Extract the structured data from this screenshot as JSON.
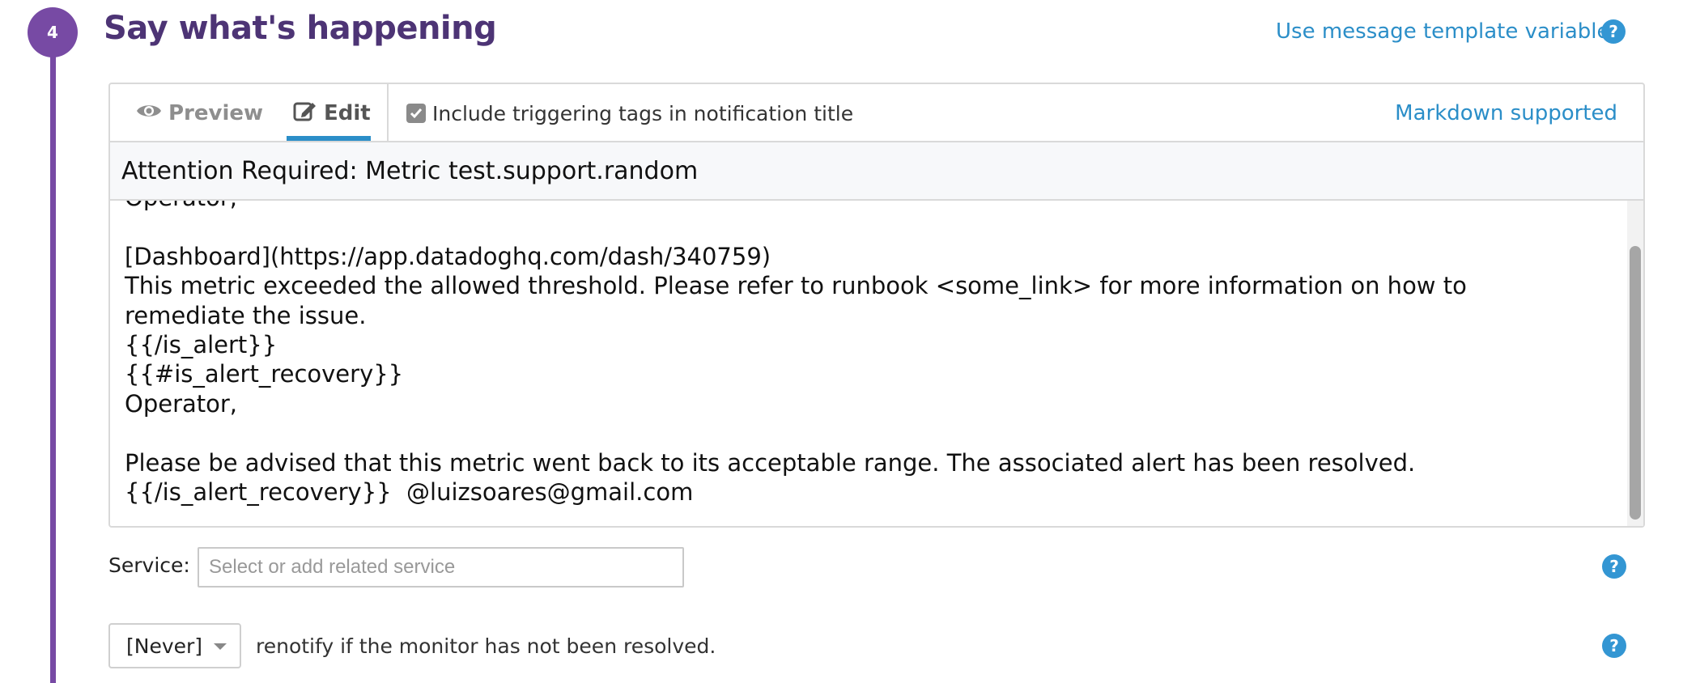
{
  "step": {
    "number": "4",
    "title": "Say what's happening",
    "template_link": "Use message template variables",
    "help_glyph": "?"
  },
  "editor": {
    "tabs": [
      {
        "label": "Preview",
        "icon": "eye-icon",
        "active": false
      },
      {
        "label": "Edit",
        "icon": "edit-icon",
        "active": true
      }
    ],
    "include_tags": {
      "label": "Include triggering tags in notification title",
      "checked": true
    },
    "markdown_label": "Markdown supported",
    "title_value": "Attention Required: Metric test.support.random",
    "body_value": "Operator,\n\n[Dashboard](https://app.datadoghq.com/dash/340759)\nThis metric exceeded the allowed threshold. Please refer to runbook <some_link> for more information on how to\nremediate the issue.\n{{/is_alert}}\n{{#is_alert_recovery}}\nOperator,\n\nPlease be advised that this metric went back to its acceptable range. The associated alert has been resolved.\n{{/is_alert_recovery}}  @luizsoares@gmail.com"
  },
  "service": {
    "label": "Service:",
    "placeholder": "Select or add related service",
    "value": ""
  },
  "renotify": {
    "selected": "[Never]",
    "text": "renotify if the monitor has not been resolved."
  },
  "colors": {
    "accent_purple": "#774aa4",
    "title_purple": "#4d3475",
    "link_blue": "#2b8ec8",
    "help_blue": "#3396d3"
  }
}
